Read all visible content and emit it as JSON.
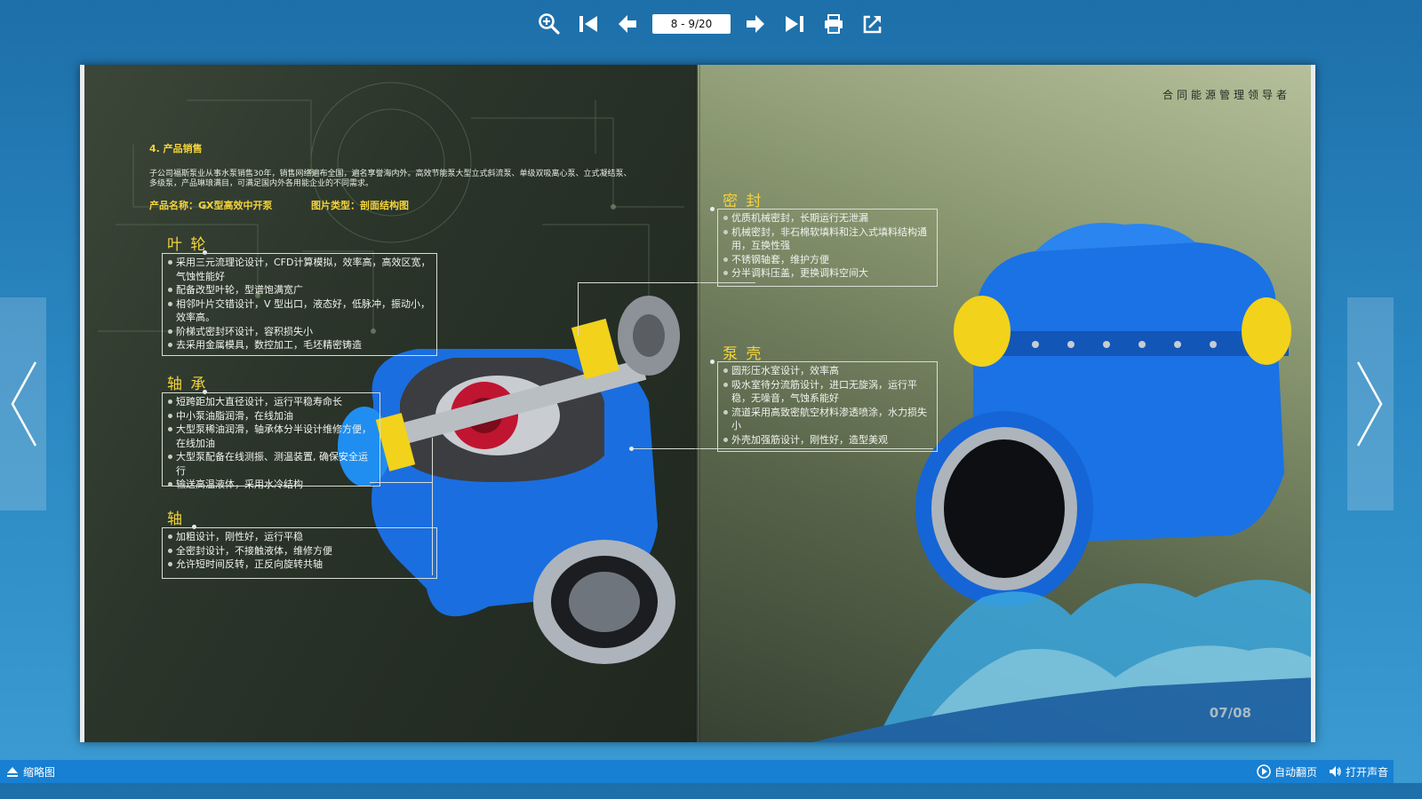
{
  "toolbar": {
    "page_indicator": "8 - 9/20",
    "icons": [
      "zoom-in-icon",
      "first-page-icon",
      "previous-page-icon",
      "next-page-icon",
      "last-page-icon",
      "print-icon",
      "share-icon"
    ]
  },
  "book": {
    "left": {
      "heading": "4. 产品销售",
      "intro_line1": "子公司福斯泵业从事水泵销售30年，销售网络遍布全国，遍名享誉海内外。高效节能泵大型立式斜流泵、单级双吸离心泵、立式凝结泵、",
      "intro_line2": "多级泵，产品琳琅满目，可满足国内外各用能企业的不同需求。",
      "product_name": "产品名称：GX型高效中开泵",
      "image_type": "图片类型：剖面结构图",
      "impeller": {
        "title": "叶 轮",
        "items": [
          "采用三元流理论设计，CFD计算模拟，效率高，高效区宽，气蚀性能好",
          "配备改型叶轮，型谱饱满宽广",
          "相邻叶片交错设计，V 型出口，液态好，低脉冲，振动小，效率高。",
          "阶梯式密封环设计，容积损失小",
          "去采用金属模具，数控加工，毛坯精密铸造"
        ]
      },
      "bearing": {
        "title": "轴 承",
        "items": [
          "短跨距加大直径设计，运行平稳寿命长",
          "中小泵油脂润滑，在线加油",
          "大型泵稀油润滑，轴承体分半设计维修方便，在线加油",
          "大型泵配备在线测振、测温装置, 确保安全运行",
          "输送高温液体，采用水冷结构"
        ]
      },
      "shaft": {
        "title": "轴",
        "items": [
          "加粗设计，刚性好，运行平稳",
          "全密封设计，不接触液体，维修方便",
          "允许短时间反转，正反向旋转共轴"
        ]
      }
    },
    "right": {
      "company": "合同能源管理领导者",
      "seal": {
        "title": "密 封",
        "items": [
          "优质机械密封，长期运行无泄漏",
          "机械密封，非石棉软填料和注入式填料结构通用，互换性强",
          "不锈钢轴套，维护方便",
          "分半调料压盖，更换调料空间大"
        ]
      },
      "casing": {
        "title": "泵 壳",
        "items": [
          "圆形压水室设计，效率高",
          "吸水室待分流筋设计，进口无旋涡，运行平稳，无噪音，气蚀系能好",
          "流道采用高致密航空材料渗透喷涂，水力损失小",
          "外壳加强筋设计，刚性好，造型美观"
        ]
      },
      "page_number": "07/08"
    }
  },
  "bottom": {
    "thumbnail_label": "缩略图",
    "autoflip_label": "自动翻页",
    "sound_label": "打开声音"
  },
  "colors": {
    "background": "#2a86c0",
    "bottom_bar": "#1780d3",
    "accent_yellow": "#f3d43a",
    "pump_blue": "#1a6ee0"
  }
}
